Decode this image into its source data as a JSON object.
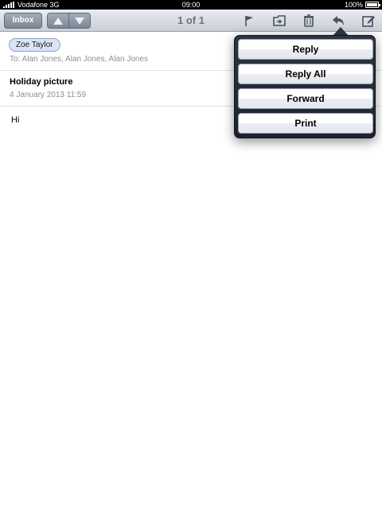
{
  "status_bar": {
    "carrier": "Vodafone 3G",
    "time": "09:00",
    "battery_percent": "100%",
    "battery_level": 1.0
  },
  "toolbar": {
    "inbox_label": "Inbox",
    "page_indicator": "1 of 1",
    "icons": [
      "chevron-up-icon",
      "chevron-down-icon",
      "flag-icon",
      "move-folder-icon",
      "trash-icon",
      "reply-icon",
      "compose-icon"
    ]
  },
  "message": {
    "from": "Zoe Taylor",
    "to_line": "To: Alan Jones, Alan Jones, Alan Jones",
    "subject": "Holiday picture",
    "date": "4 January 2013 11:59",
    "body": "Hi"
  },
  "reply_menu": {
    "items": [
      {
        "label": "Reply"
      },
      {
        "label": "Reply All"
      },
      {
        "label": "Forward"
      },
      {
        "label": "Print"
      }
    ]
  },
  "colors": {
    "toolbar_top": "#e9ecf0",
    "toolbar_bottom": "#c9ced6",
    "popover": "#2e3646",
    "sender_chip": "#dbe4f4"
  }
}
